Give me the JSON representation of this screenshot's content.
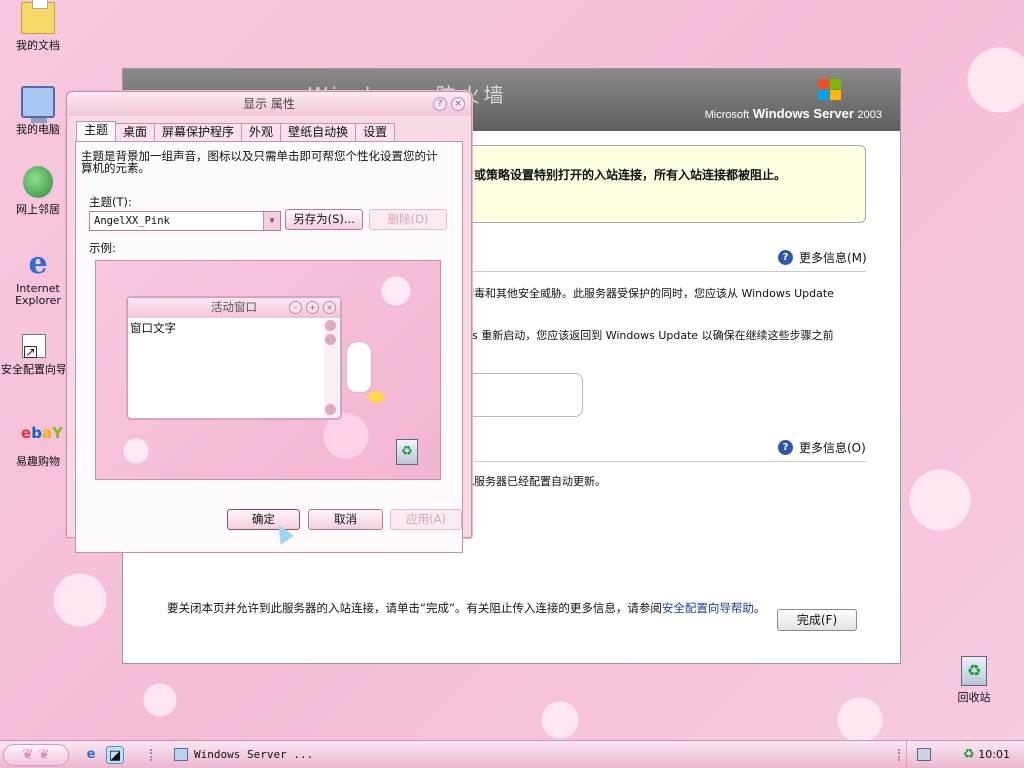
{
  "desktop": {
    "icons": [
      {
        "label": "我的文档",
        "icon": "my-documents-icon"
      },
      {
        "label": "我的电脑",
        "icon": "my-computer-icon"
      },
      {
        "label": "网上邻居",
        "icon": "network-places-icon"
      },
      {
        "label": "Internet Explorer",
        "icon": "internet-explorer-icon"
      },
      {
        "label": "安全配置向导",
        "icon": "security-wizard-shortcut-icon"
      },
      {
        "label": "易趣购物",
        "icon": "ebay-shortcut-icon"
      },
      {
        "label": "回收站",
        "icon": "recycle-bin-icon"
      }
    ]
  },
  "security_window": {
    "header_title": "Windows 防火墙",
    "brand_line1": "Microsoft",
    "brand_line2": "Windows Server",
    "brand_version": "2003",
    "warning_text": "或策略设置特别打开的入站连接，所有入站连接都被阻止。",
    "more_info_1": "更多信息(M)",
    "text_1": "病毒和其他安全威胁。此服务器受保护的同时，您应该从 Windows Update",
    "text_2": "ws 重新启动，您应该返回到 Windows Update 以确保在继续这些步骤之前",
    "more_info_2": "更多信息(O)",
    "text_3": "此服务器已经配置自动更新。",
    "bottom_text": "要关闭本页并允许到此服务器的入站连接，请单击“完成”。有关阻止传入连接的更多信息，请参阅",
    "bottom_link": "安全配置向导帮助",
    "bottom_end": "。",
    "finish_button": "完成(F)"
  },
  "display_dialog": {
    "title": "显示 属性",
    "tabs": [
      "主题",
      "桌面",
      "屏幕保护程序",
      "外观",
      "壁纸自动换",
      "设置"
    ],
    "description": "主题是背景加一组声音，图标以及只需单击即可帮您个性化设置您的计算机的元素。",
    "theme_label": "主题(T):",
    "theme_value": "AngelXX_Pink",
    "save_as_button": "另存为(S)...",
    "delete_button": "删除(D)",
    "sample_label": "示例:",
    "preview_window_title": "活动窗口",
    "preview_window_text": "窗口文字",
    "ok_button": "确定",
    "cancel_button": "取消",
    "apply_button": "应用(A)"
  },
  "taskbar": {
    "task_label": "Windows Server ...",
    "clock": "10:01"
  },
  "colors": {
    "desktop_bg": "#f6c7dd",
    "dialog_bg": "#f6d9e6",
    "warning_bg": "#ffffe1",
    "header_gray": "#6e6e6e"
  }
}
